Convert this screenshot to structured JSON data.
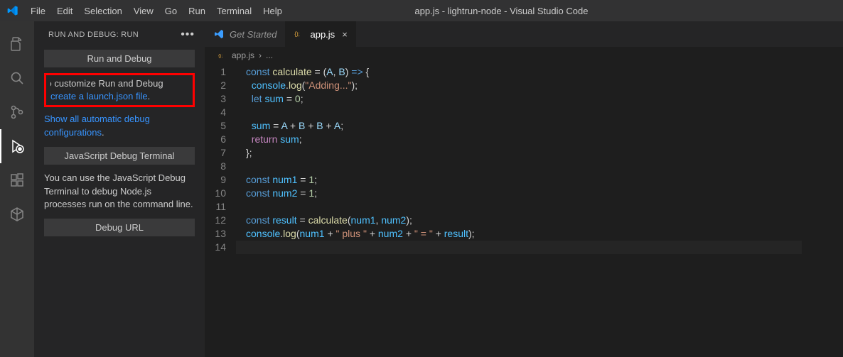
{
  "window": {
    "title": "app.js - lightrun-node - Visual Studio Code"
  },
  "menu": [
    "File",
    "Edit",
    "Selection",
    "View",
    "Go",
    "Run",
    "Terminal",
    "Help"
  ],
  "activity": [
    "explorer",
    "search",
    "source-control",
    "run-debug",
    "extensions",
    "remote"
  ],
  "sidebar": {
    "header": "RUN AND DEBUG: RUN",
    "run_btn": "Run and Debug",
    "highlight_line1": "To customize Run and Debug",
    "highlight_link": "create a launch.json file",
    "show_all_1": "Show all automatic debug",
    "show_all_2": "configurations",
    "js_btn": "JavaScript Debug Terminal",
    "js_text": "You can use the JavaScript Debug Terminal to debug Node.js processes run on the command line.",
    "url_btn": "Debug URL"
  },
  "tabs": {
    "get_started": "Get Started",
    "appjs": "app.js"
  },
  "breadcrumb": {
    "file": "app.js",
    "sep": "›",
    "rest": "..."
  },
  "code": {
    "lines": [
      [
        [
          "kw",
          "const"
        ],
        [
          "sp",
          " "
        ],
        [
          "fn",
          "calculate"
        ],
        [
          "sp",
          " "
        ],
        [
          "op",
          "="
        ],
        [
          "sp",
          " "
        ],
        [
          "pun",
          "("
        ],
        [
          "param",
          "A"
        ],
        [
          "pun",
          ","
        ],
        [
          "sp",
          " "
        ],
        [
          "param",
          "B"
        ],
        [
          "pun",
          ")"
        ],
        [
          "sp",
          " "
        ],
        [
          "kw",
          "=>"
        ],
        [
          "sp",
          " "
        ],
        [
          "pun",
          "{"
        ]
      ],
      [
        [
          "sp",
          "  "
        ],
        [
          "var",
          "console"
        ],
        [
          "pun",
          "."
        ],
        [
          "fn",
          "log"
        ],
        [
          "pun",
          "("
        ],
        [
          "str",
          "\"Adding...\""
        ],
        [
          "pun",
          ");"
        ]
      ],
      [
        [
          "sp",
          "  "
        ],
        [
          "kw",
          "let"
        ],
        [
          "sp",
          " "
        ],
        [
          "var",
          "sum"
        ],
        [
          "sp",
          " "
        ],
        [
          "op",
          "="
        ],
        [
          "sp",
          " "
        ],
        [
          "num",
          "0"
        ],
        [
          "pun",
          ";"
        ]
      ],
      [],
      [
        [
          "sp",
          "  "
        ],
        [
          "var",
          "sum"
        ],
        [
          "sp",
          " "
        ],
        [
          "op",
          "="
        ],
        [
          "sp",
          " "
        ],
        [
          "param",
          "A"
        ],
        [
          "sp",
          " "
        ],
        [
          "op",
          "+"
        ],
        [
          "sp",
          " "
        ],
        [
          "param",
          "B"
        ],
        [
          "sp",
          " "
        ],
        [
          "op",
          "+"
        ],
        [
          "sp",
          " "
        ],
        [
          "param",
          "B"
        ],
        [
          "sp",
          " "
        ],
        [
          "op",
          "+"
        ],
        [
          "sp",
          " "
        ],
        [
          "param",
          "A"
        ],
        [
          "pun",
          ";"
        ]
      ],
      [
        [
          "sp",
          "  "
        ],
        [
          "ctl",
          "return"
        ],
        [
          "sp",
          " "
        ],
        [
          "var",
          "sum"
        ],
        [
          "pun",
          ";"
        ]
      ],
      [
        [
          "pun",
          "};"
        ]
      ],
      [],
      [
        [
          "kw",
          "const"
        ],
        [
          "sp",
          " "
        ],
        [
          "var",
          "num1"
        ],
        [
          "sp",
          " "
        ],
        [
          "op",
          "="
        ],
        [
          "sp",
          " "
        ],
        [
          "num",
          "1"
        ],
        [
          "pun",
          ";"
        ]
      ],
      [
        [
          "kw",
          "const"
        ],
        [
          "sp",
          " "
        ],
        [
          "var",
          "num2"
        ],
        [
          "sp",
          " "
        ],
        [
          "op",
          "="
        ],
        [
          "sp",
          " "
        ],
        [
          "num",
          "1"
        ],
        [
          "pun",
          ";"
        ]
      ],
      [],
      [
        [
          "kw",
          "const"
        ],
        [
          "sp",
          " "
        ],
        [
          "var",
          "result"
        ],
        [
          "sp",
          " "
        ],
        [
          "op",
          "="
        ],
        [
          "sp",
          " "
        ],
        [
          "fn",
          "calculate"
        ],
        [
          "pun",
          "("
        ],
        [
          "var",
          "num1"
        ],
        [
          "pun",
          ","
        ],
        [
          "sp",
          " "
        ],
        [
          "var",
          "num2"
        ],
        [
          "pun",
          ");"
        ]
      ],
      [
        [
          "var",
          "console"
        ],
        [
          "pun",
          "."
        ],
        [
          "fn",
          "log"
        ],
        [
          "pun",
          "("
        ],
        [
          "var",
          "num1"
        ],
        [
          "sp",
          " "
        ],
        [
          "op",
          "+"
        ],
        [
          "sp",
          " "
        ],
        [
          "str",
          "\" plus \""
        ],
        [
          "sp",
          " "
        ],
        [
          "op",
          "+"
        ],
        [
          "sp",
          " "
        ],
        [
          "var",
          "num2"
        ],
        [
          "sp",
          " "
        ],
        [
          "op",
          "+"
        ],
        [
          "sp",
          " "
        ],
        [
          "str",
          "\" = \""
        ],
        [
          "sp",
          " "
        ],
        [
          "op",
          "+"
        ],
        [
          "sp",
          " "
        ],
        [
          "var",
          "result"
        ],
        [
          "pun",
          ");"
        ]
      ],
      []
    ]
  }
}
